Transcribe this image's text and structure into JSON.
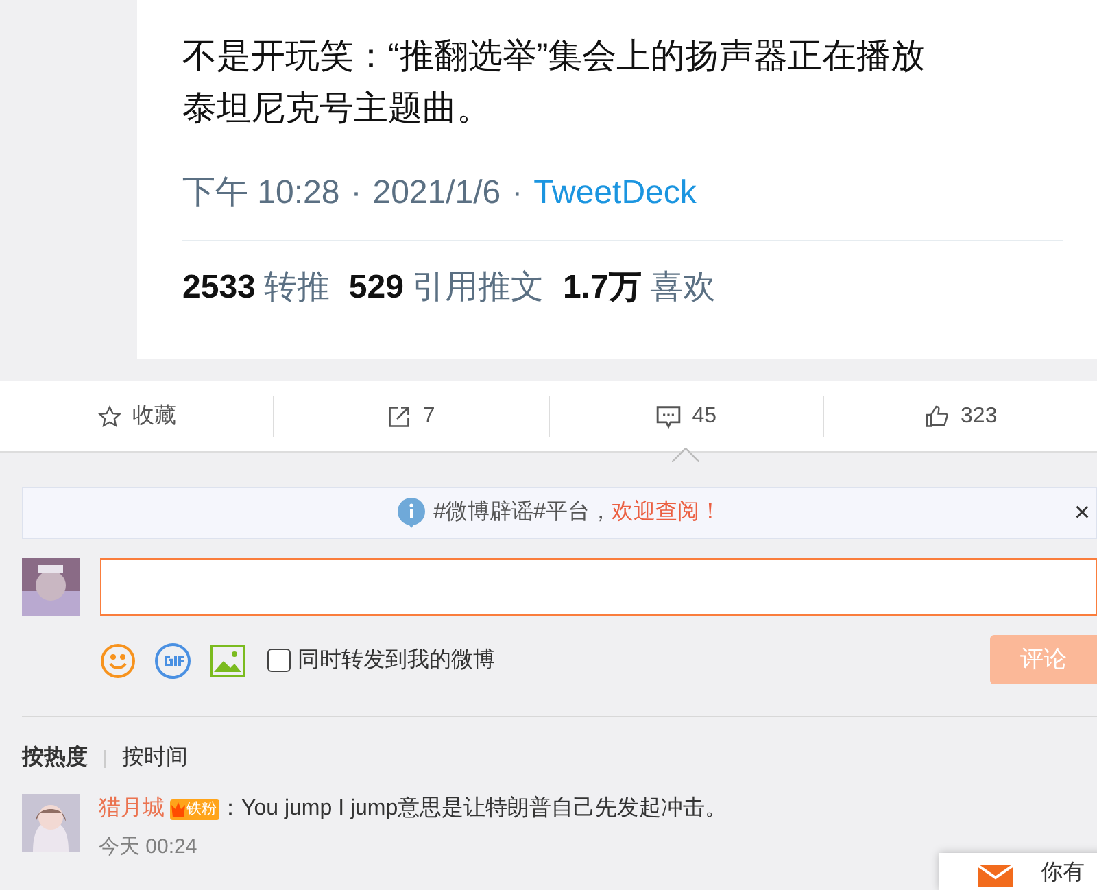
{
  "tweet": {
    "text_lines": [
      "不是开玩笑：“推翻选举”集会上的扬声器正在播放",
      "泰坦尼克号主题曲。"
    ],
    "time": "下午 10:28",
    "separator": "·",
    "date": "2021/1/6",
    "source": "TweetDeck",
    "stats": [
      {
        "count": "2533",
        "label": "转推"
      },
      {
        "count": "529",
        "label": "引用推文"
      },
      {
        "count": "1.7万",
        "label": "喜欢"
      }
    ]
  },
  "actions": [
    {
      "kind": "star",
      "label": "收藏",
      "selected": false
    },
    {
      "kind": "share",
      "label": "7",
      "selected": false
    },
    {
      "kind": "comment",
      "label": "45",
      "selected": true
    },
    {
      "kind": "like",
      "label": "323",
      "selected": false
    }
  ],
  "notice": {
    "text": "#微博辟谣#平台，",
    "link": "欢迎查阅！",
    "close": "×"
  },
  "composer": {
    "forward_label": "同时转发到我的微博",
    "forward_checked": false,
    "submit": "评论"
  },
  "sort_tabs": [
    {
      "label": "按热度",
      "selected": true
    },
    {
      "label": "按时间",
      "selected": false
    }
  ],
  "comments": [
    {
      "user": "猎月城",
      "badge": "铁粉",
      "text": "：You jump I jump意思是让特朗普自己先发起冲击。",
      "time": "今天 00:24"
    }
  ],
  "popup": {
    "text": "你有"
  }
}
